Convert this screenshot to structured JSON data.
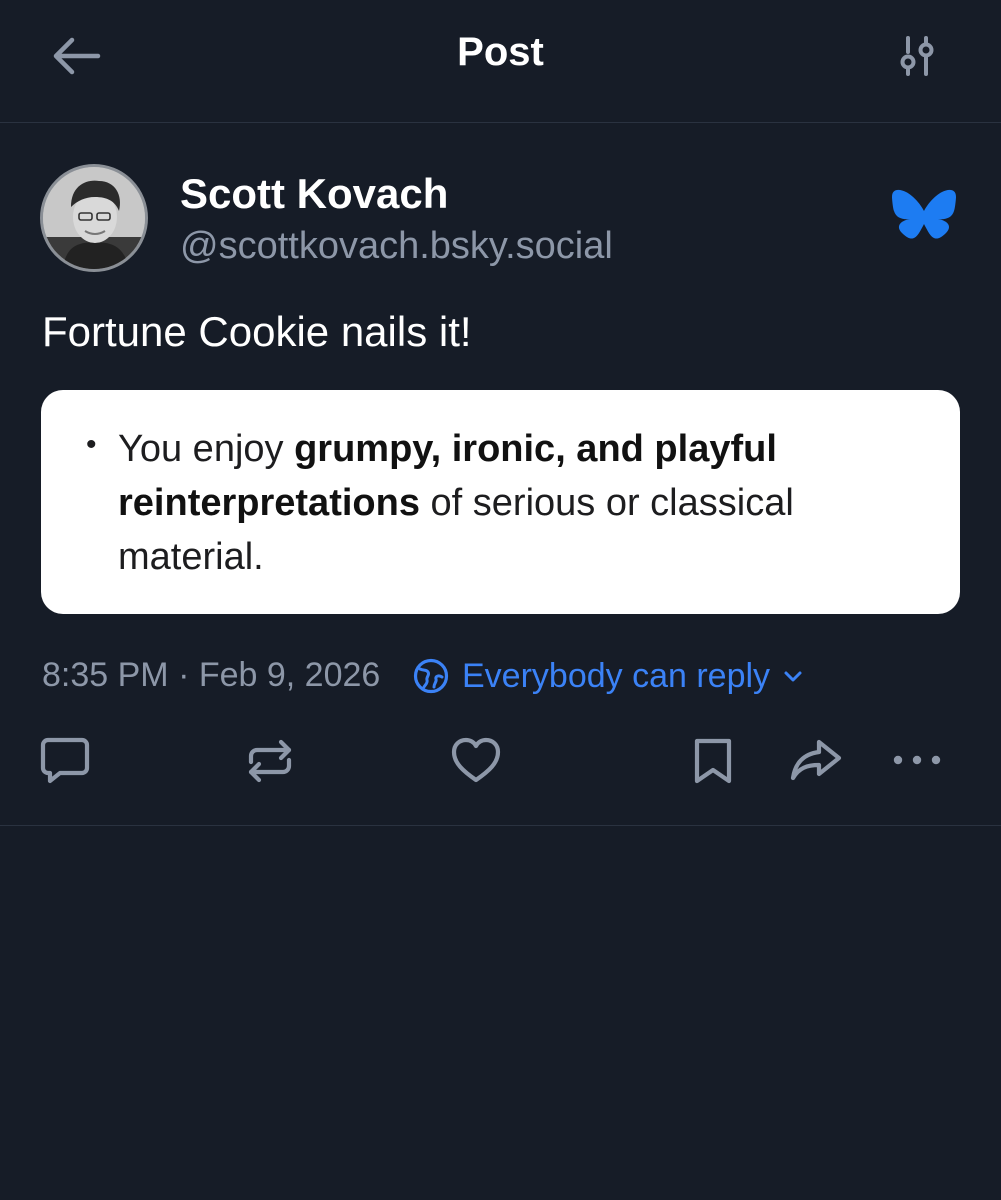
{
  "header": {
    "title": "Post",
    "back_icon": "arrow-left-icon",
    "settings_icon": "sliders-icon"
  },
  "author": {
    "display_name": "Scott Kovach",
    "handle": "@scottkovach.bsky.social",
    "avatar": "avatar-photo",
    "network_logo": "bluesky-butterfly-icon"
  },
  "post": {
    "text": "Fortune Cookie nails it!",
    "embed": {
      "bullet": "•",
      "prefix": "You enjoy ",
      "bold": "grumpy, ironic, and playful reinterpretations",
      "suffix": " of serious or classical material."
    },
    "timestamp": "8:35 PM · Feb 9, 2026",
    "reply_setting": "Everybody can reply"
  },
  "actions": [
    {
      "name": "reply",
      "icon": "speech-bubble-icon"
    },
    {
      "name": "repost",
      "icon": "repost-arrows-icon"
    },
    {
      "name": "like",
      "icon": "heart-icon"
    },
    {
      "name": "bookmark",
      "icon": "bookmark-icon"
    },
    {
      "name": "share",
      "icon": "share-arrow-icon"
    },
    {
      "name": "more",
      "icon": "ellipsis-icon"
    }
  ],
  "colors": {
    "background": "#161c27",
    "accent": "#3b82f6",
    "muted_text": "#8d97a8",
    "icon": "#8d97a8",
    "divider": "#2a3240"
  }
}
